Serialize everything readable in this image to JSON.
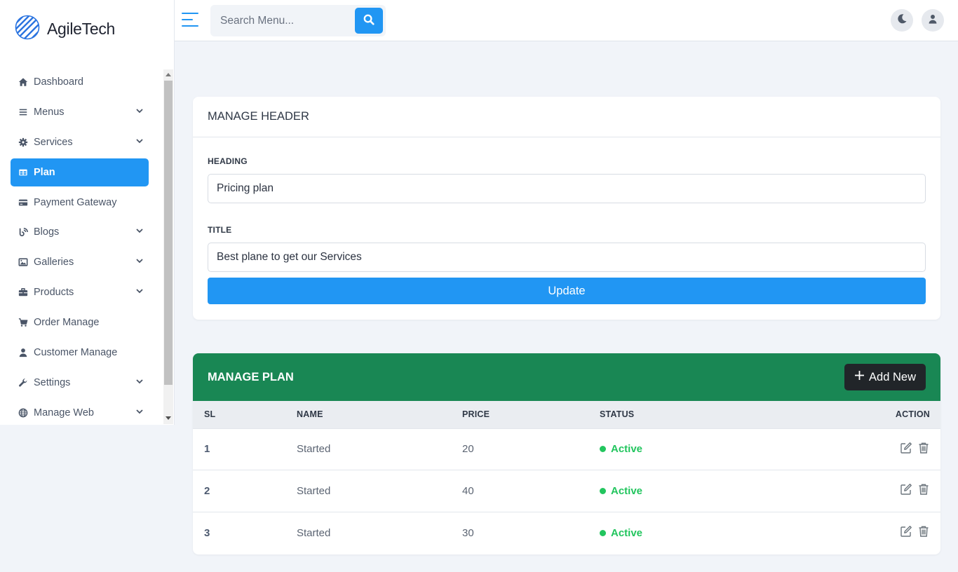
{
  "brand": {
    "name": "AgileTech"
  },
  "sidebar": {
    "items": [
      {
        "label": "Dashboard",
        "icon": "home-icon",
        "has_submenu": false
      },
      {
        "label": "Menus",
        "icon": "bars-icon",
        "has_submenu": true
      },
      {
        "label": "Services",
        "icon": "gear-icon",
        "has_submenu": true
      },
      {
        "label": "Plan",
        "icon": "table-icon",
        "has_submenu": false,
        "active": true
      },
      {
        "label": "Payment Gateway",
        "icon": "credit-card-icon",
        "has_submenu": false
      },
      {
        "label": "Blogs",
        "icon": "blog-icon",
        "has_submenu": true
      },
      {
        "label": "Galleries",
        "icon": "image-icon",
        "has_submenu": true
      },
      {
        "label": "Products",
        "icon": "briefcase-icon",
        "has_submenu": true
      },
      {
        "label": "Order Manage",
        "icon": "cart-icon",
        "has_submenu": false
      },
      {
        "label": "Customer Manage",
        "icon": "user-icon",
        "has_submenu": false
      },
      {
        "label": "Settings",
        "icon": "wrench-icon",
        "has_submenu": true
      },
      {
        "label": "Manage Web",
        "icon": "globe-icon",
        "has_submenu": true
      }
    ]
  },
  "topbar": {
    "search_placeholder": "Search Menu...",
    "search_value": ""
  },
  "manage_header": {
    "title": "MANAGE HEADER",
    "heading_label": "HEADING",
    "heading_value": "Pricing plan",
    "title_label": "TITLE",
    "title_value": "Best plane to get our Services",
    "update_label": "Update"
  },
  "manage_plan": {
    "title": "MANAGE PLAN",
    "add_label": "Add New",
    "columns": {
      "sl": "SL",
      "name": "NAME",
      "price": "PRICE",
      "status": "STATUS",
      "action": "ACTION"
    },
    "rows": [
      {
        "sl": "1",
        "name": "Started",
        "price": "20",
        "status": "Active"
      },
      {
        "sl": "2",
        "name": "Started",
        "price": "40",
        "status": "Active"
      },
      {
        "sl": "3",
        "name": "Started",
        "price": "30",
        "status": "Active"
      }
    ]
  },
  "colors": {
    "primary": "#2196f3",
    "success_header": "#198754",
    "status_active": "#22c55e",
    "dark_button": "#212529"
  }
}
